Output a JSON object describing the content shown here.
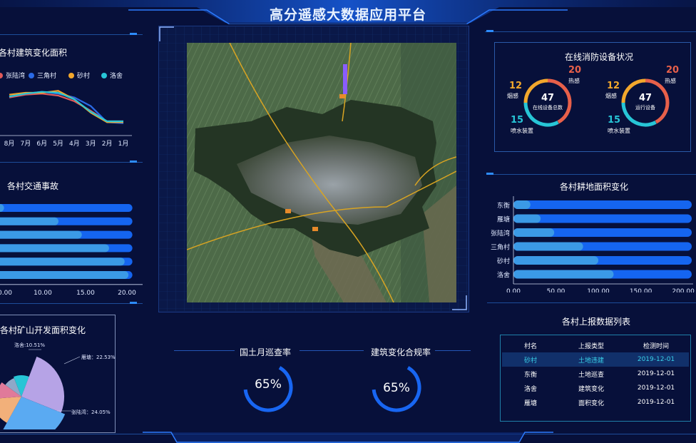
{
  "header": {
    "title": "高分遥感大数据应用平台"
  },
  "building_chart": {
    "title": "各村建筑变化面积",
    "legend": [
      {
        "label": "张陆湾",
        "color": "#e05a5a"
      },
      {
        "label": "三角村",
        "color": "#2a6ae6"
      },
      {
        "label": "砂村",
        "color": "#f2a72c"
      },
      {
        "label": "洛舍",
        "color": "#27c5d6"
      }
    ],
    "x_labels": [
      "8月",
      "7月",
      "6月",
      "5月",
      "4月",
      "3月",
      "2月",
      "1月"
    ]
  },
  "traffic_chart": {
    "title": "各村交通事故",
    "x_ticks": [
      "0.00",
      "10.00",
      "15.00",
      "20.00"
    ]
  },
  "mining_chart": {
    "title": "各村矿山开发面积变化",
    "labels": [
      "洛舍:10.51%",
      "雁塘：22.53%",
      "张陆湾：24.05%"
    ]
  },
  "fire_panel": {
    "title": "在线消防设备状况",
    "left": {
      "smoke_count": "12",
      "smoke_label": "烟感",
      "heat_count": "20",
      "heat_label": "热感",
      "spray_count": "15",
      "spray_label": "喷水装置",
      "center_value": "47",
      "center_label": "在线设备总数"
    },
    "right": {
      "smoke_count": "12",
      "smoke_label": "烟感",
      "heat_count": "20",
      "heat_label": "热感",
      "spray_count": "15",
      "spray_label": "喷水装置",
      "center_value": "47",
      "center_label": "运行设备"
    }
  },
  "farmland_chart": {
    "title": "各村耕地面积变化",
    "categories": [
      "东衡",
      "雁塘",
      "张陆湾",
      "三角村",
      "砂村",
      "洛舍"
    ],
    "x_ticks": [
      "0.00",
      "50.00",
      "100.00",
      "150.00",
      "200.00"
    ]
  },
  "report_table": {
    "title": "各村上报数据列表",
    "headers": [
      "村名",
      "上报类型",
      "检测时间"
    ],
    "rows": [
      {
        "village": "砂村",
        "type": "土地违建",
        "date": "2019-12-01",
        "highlight": true
      },
      {
        "village": "东衡",
        "type": "土地巡查",
        "date": "2019-12-01",
        "highlight": false
      },
      {
        "village": "洛舍",
        "type": "建筑变化",
        "date": "2019-12-01",
        "highlight": false
      },
      {
        "village": "雁塘",
        "type": "面积变化",
        "date": "2019-12-01",
        "highlight": false
      }
    ]
  },
  "gauges": [
    {
      "title": "国土月巡查率",
      "value": "65%",
      "fraction": 0.65
    },
    {
      "title": "建筑变化合规率",
      "value": "65%",
      "fraction": 0.65
    }
  ],
  "chart_data": [
    {
      "type": "line",
      "title": "各村建筑变化面积",
      "x": [
        "8月",
        "7月",
        "6月",
        "5月",
        "4月",
        "3月",
        "2月",
        "1月"
      ],
      "series": [
        {
          "name": "张陆湾",
          "color": "#e05a5a",
          "values": [
            40,
            43,
            44,
            42,
            36,
            26,
            15,
            15
          ]
        },
        {
          "name": "三角村",
          "color": "#2a6ae6",
          "values": [
            41,
            44,
            46,
            44,
            40,
            31,
            14,
            13
          ]
        },
        {
          "name": "砂村",
          "color": "#f2a72c",
          "values": [
            43,
            45,
            45,
            47,
            38,
            24,
            14,
            14
          ]
        },
        {
          "name": "洛舍",
          "color": "#27c5d6",
          "values": [
            41,
            44,
            46,
            45,
            38,
            25,
            15,
            15
          ]
        }
      ],
      "ylim": [
        0,
        60
      ]
    },
    {
      "type": "bar",
      "title": "各村交通事故",
      "orientation": "horizontal",
      "track_max": 20.5,
      "values": [
        4,
        11,
        14,
        17.5,
        19.5,
        20
      ],
      "xlim": [
        0,
        22
      ]
    },
    {
      "type": "pie",
      "title": "各村矿山开发面积变化",
      "slices": [
        {
          "label": "洛舍",
          "value": 10.51,
          "color": "#27c5d6"
        },
        {
          "label": "雁塘",
          "value": 22.53,
          "color": "#b6a3e6"
        },
        {
          "label": "张陆湾",
          "value": 24.05,
          "color": "#5aaaf2"
        },
        {
          "label": "",
          "value": 14.0,
          "color": "#f2b07a"
        },
        {
          "label": "",
          "value": 10.0,
          "color": "#e07a9a"
        },
        {
          "label": "",
          "value": 8.0,
          "color": "#8fa8c8"
        }
      ]
    },
    {
      "type": "bar",
      "title": "各村耕地面积变化",
      "orientation": "horizontal",
      "categories": [
        "东衡",
        "雁塘",
        "张陆湾",
        "三角村",
        "砂村",
        "洛舍"
      ],
      "values": [
        20,
        32,
        48,
        82,
        100,
        118
      ],
      "track_max": 210,
      "xlim": [
        0,
        210
      ]
    }
  ]
}
